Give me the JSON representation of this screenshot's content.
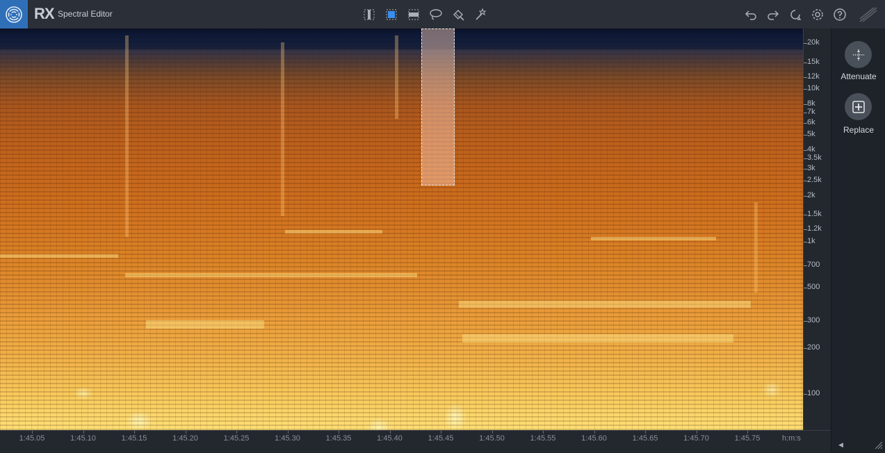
{
  "app": {
    "logo_text": "RX",
    "module_name": "Spectral Editor"
  },
  "toolbar": {
    "tools": [
      {
        "name": "time-selection-tool",
        "icon": "time-selection-icon",
        "active": false
      },
      {
        "name": "time-frequency-selection-tool",
        "icon": "rect-selection-icon",
        "active": true
      },
      {
        "name": "frequency-selection-tool",
        "icon": "frequency-selection-icon",
        "active": false
      },
      {
        "name": "lasso-tool",
        "icon": "lasso-icon",
        "active": false
      },
      {
        "name": "brush-tool",
        "icon": "brush-icon",
        "active": false
      },
      {
        "name": "magic-wand-tool",
        "icon": "magic-wand-icon",
        "active": false
      }
    ],
    "right_icons": [
      "undo-icon",
      "redo-icon",
      "history-icon",
      "settings-icon",
      "help-icon",
      "logo-mark-icon"
    ]
  },
  "colors": {
    "accent": "#2f6fb8",
    "active_tool": "#3a8ef0",
    "panel_bg": "#1e232a",
    "toolbar_bg": "#2a2f38"
  },
  "freq_axis": {
    "labels": [
      "20k",
      "15k",
      "12k",
      "10k",
      "8k",
      "7k",
      "6k",
      "5k",
      "4k",
      "3.5k",
      "3k",
      "2.5k",
      "2k",
      "1.5k",
      "1.2k",
      "1k",
      "700",
      "500",
      "300",
      "200",
      "100"
    ],
    "values_hz": [
      20000,
      15000,
      12000,
      10000,
      8000,
      7000,
      6000,
      5000,
      4000,
      3500,
      3000,
      2500,
      2000,
      1500,
      1200,
      1000,
      700,
      500,
      300,
      200,
      100
    ],
    "scale": "log"
  },
  "time_axis": {
    "labels": [
      "1:45.05",
      "1:45.10",
      "1:45.15",
      "1:45.20",
      "1:45.25",
      "1:45.30",
      "1:45.35",
      "1:45.40",
      "1:45.45",
      "1:45.50",
      "1:45.55",
      "1:45.60",
      "1:45.65",
      "1:45.70",
      "1:45.75"
    ],
    "unit": "h:m:s"
  },
  "selection": {
    "time_start": "1:45.43",
    "time_end": "1:45.46",
    "freq_low_hz": 5000,
    "freq_high_hz": 22050
  },
  "right_panel": {
    "actions": [
      {
        "label": "Attenuate",
        "icon": "attenuate-icon"
      },
      {
        "label": "Replace",
        "icon": "replace-icon"
      }
    ]
  }
}
